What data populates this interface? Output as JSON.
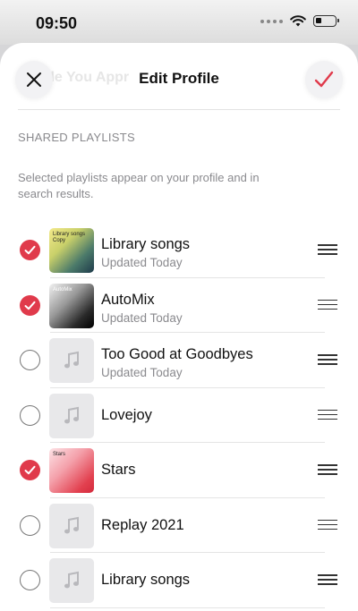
{
  "status_bar": {
    "time": "09:50"
  },
  "header": {
    "title": "Edit Profile",
    "background_title": "ile You Appr",
    "close_icon": "close-icon",
    "done_icon": "checkmark-icon",
    "accent_color": "#e03a4b"
  },
  "section": {
    "title": "SHARED PLAYLISTS",
    "description": "Selected playlists appear on your profile and in search results."
  },
  "playlists": [
    {
      "name": "Library songs",
      "subtitle": "Updated Today",
      "selected": true,
      "art_label": "Library songs Copy",
      "art_style": "library"
    },
    {
      "name": "AutoMix",
      "subtitle": "Updated Today",
      "selected": true,
      "art_label": "AutoMix",
      "art_style": "automix"
    },
    {
      "name": "Too Good at Goodbyes",
      "subtitle": "Updated Today",
      "selected": false,
      "art_label": "",
      "art_style": "placeholder"
    },
    {
      "name": "Lovejoy",
      "subtitle": "",
      "selected": false,
      "art_label": "",
      "art_style": "placeholder"
    },
    {
      "name": "Stars",
      "subtitle": "",
      "selected": true,
      "art_label": "Stars",
      "art_style": "stars"
    },
    {
      "name": "Replay 2021",
      "subtitle": "",
      "selected": false,
      "art_label": "",
      "art_style": "placeholder"
    },
    {
      "name": "Library songs",
      "subtitle": "",
      "selected": false,
      "art_label": "",
      "art_style": "placeholder"
    }
  ]
}
